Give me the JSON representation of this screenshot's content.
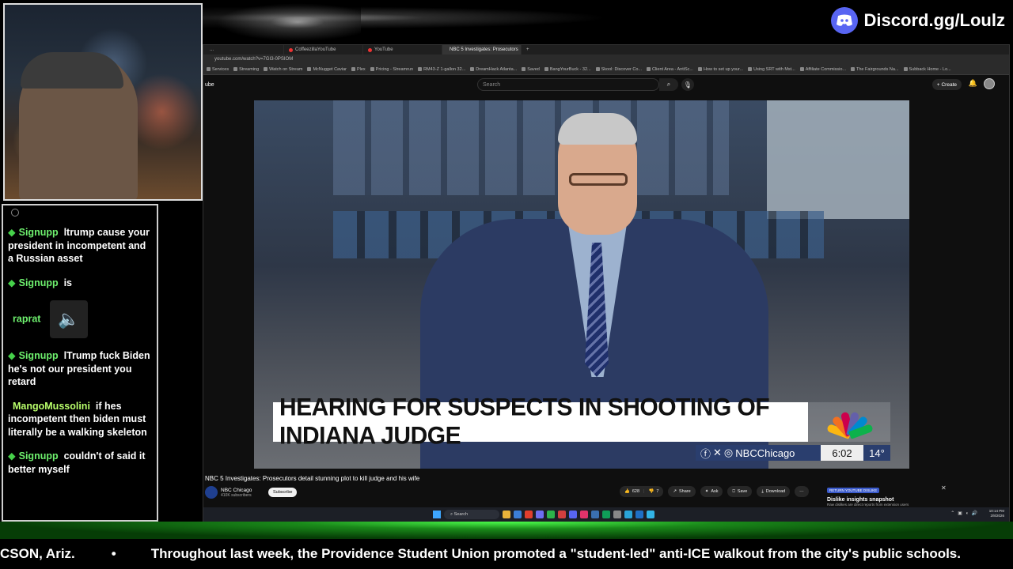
{
  "overlay": {
    "discord_text": "Discord.gg/Loulz"
  },
  "chat": {
    "messages": [
      {
        "user": "Signupp",
        "text": "ltrump cause your president in incompetent and a Russian asset"
      },
      {
        "user": "Signupp",
        "text": "is"
      },
      {
        "user": "raprat",
        "text": ""
      },
      {
        "user": "Signupp",
        "text": "lTrump fuck Biden he's not our president you retard"
      },
      {
        "user": "MangoMussolini",
        "text": "if hes incompetent then biden must literally be a walking skeleton"
      },
      {
        "user": "Signupp",
        "text": "couldn't of said it better myself"
      }
    ]
  },
  "browser": {
    "tabs": [
      {
        "label": "...",
        "active": false
      },
      {
        "label": "CoffeezillaYouTube",
        "active": false
      },
      {
        "label": "YouTube",
        "active": false
      },
      {
        "label": "NBC 5 Investigates: Prosecutors",
        "active": true
      }
    ],
    "address": "youtube.com/watch?v=7GI3-0PSIOM",
    "bookmarks": [
      "Services",
      "Streaming",
      "Watch on Stream",
      "McNugget Caviar",
      "Plex",
      "Pricing - Streamrun",
      "RM43-Z 1-gallon 32...",
      "DreamHack Atlanta...",
      "Saved",
      "BangYourBuck - 32...",
      "Skool: Discover Co...",
      "Client Area - AntiSc...",
      "How to set up your...",
      "Using SRT with Mst...",
      "Affiliate Commissio...",
      "The Fairgrounds Na...",
      "Subback Home - Lo..."
    ]
  },
  "youtube": {
    "logo_text": "ube",
    "search_placeholder": "Search",
    "create_label": "Create",
    "video": {
      "headline": "HEARING FOR SUSPECTS IN SHOOTING OF INDIANA JUDGE",
      "social_handle": "NBCChicago",
      "time": "6:02",
      "temperature": "14°"
    },
    "title": "NBC 5 Investigates: Prosecutors detail stunning plot to kill judge and his wife",
    "channel": {
      "name": "NBC Chicago",
      "subscribers": "410K subscribers",
      "subscribe_label": "Subscribe"
    },
    "actions": {
      "likes": "628",
      "dislikes": "7",
      "share": "Share",
      "ask": "Ask",
      "save": "Save",
      "download": "Download"
    },
    "dislike_panel": {
      "tag": "RETURN YOUTUBE DISLIKE",
      "title": "Dislike insights snapshot",
      "subtitle": "Raw dislikes are direct reports from extension users"
    }
  },
  "taskbar": {
    "search_label": "Search",
    "time": "10:14 PM",
    "date": "2/8/2026"
  },
  "ticker": {
    "text_left": "CSON, Ariz.",
    "separator": "•",
    "text_main": "Throughout last week, the Providence Student Union promoted a \"student-led\" anti-ICE walkout from the city's public schools."
  },
  "colors": {
    "discord": "#5865F2",
    "chat_name": "#6ef06e",
    "lower_third_bg": "#ffffff",
    "info_bar": "#2a3e6e"
  }
}
